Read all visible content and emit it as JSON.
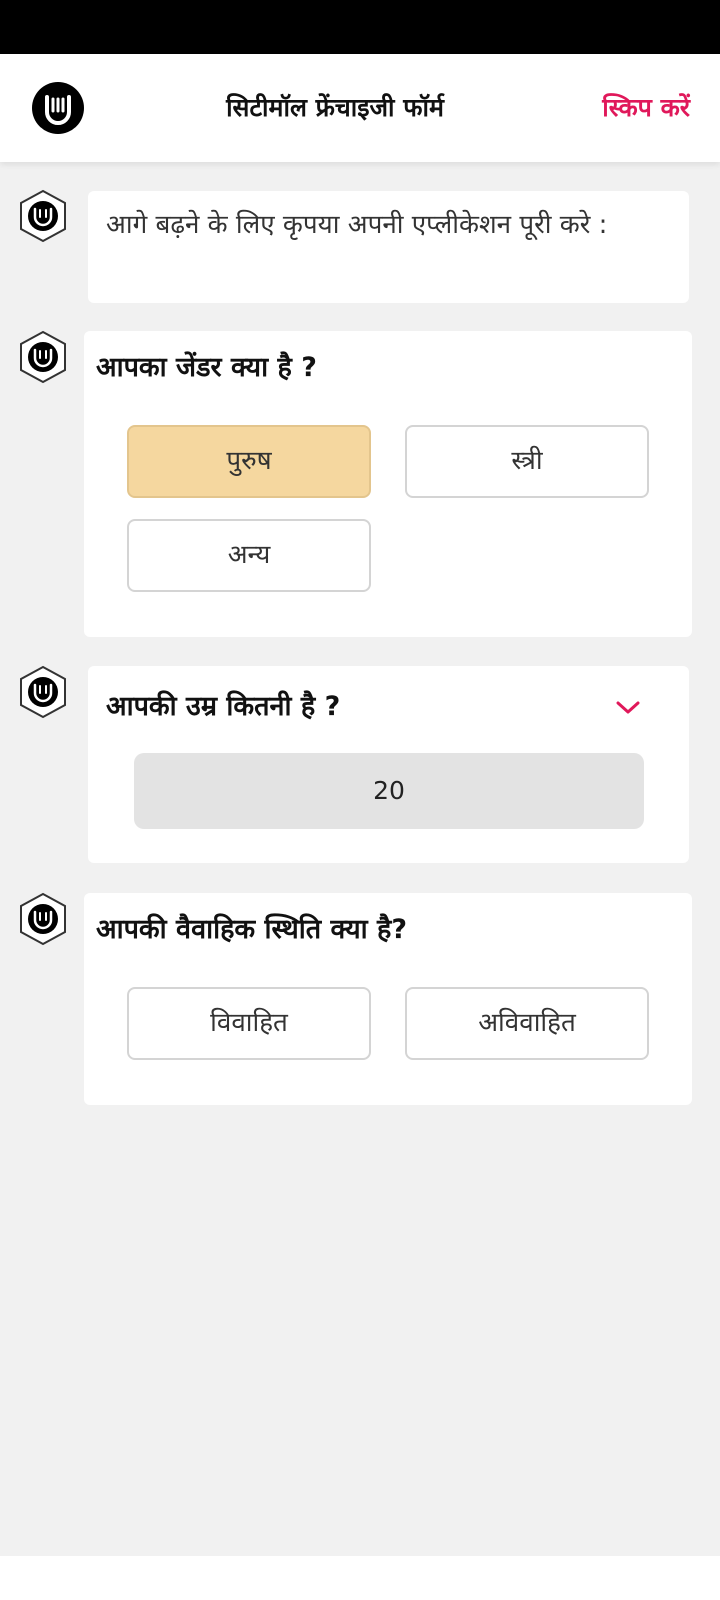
{
  "header": {
    "title": "सिटीमॉल फ्रेंचाइजी फॉर्म",
    "skip_label": "स्किप करें",
    "logo_icon": "citymall-logo-icon"
  },
  "intro": {
    "text": "आगे बढ़ने के  लिए  कृपया अपनी एप्लीकेशन पूरी करे  :"
  },
  "gender": {
    "question": "आपका जेंडर क्या है ?",
    "options": [
      "पुरुष",
      "स्त्री",
      "अन्य"
    ],
    "selected": "पुरुष"
  },
  "age": {
    "question": "आपकी उम्र कितनी है ?",
    "value": "20",
    "toggle_icon": "chevron-down-icon"
  },
  "marital": {
    "question": "आपकी वैवाहिक स्थिति क्या है?",
    "options": [
      "विवाहित",
      "अविवाहित"
    ]
  },
  "colors": {
    "accent": "#e0185a",
    "selected_option": "#f5d79f",
    "background": "#f1f1f1"
  }
}
